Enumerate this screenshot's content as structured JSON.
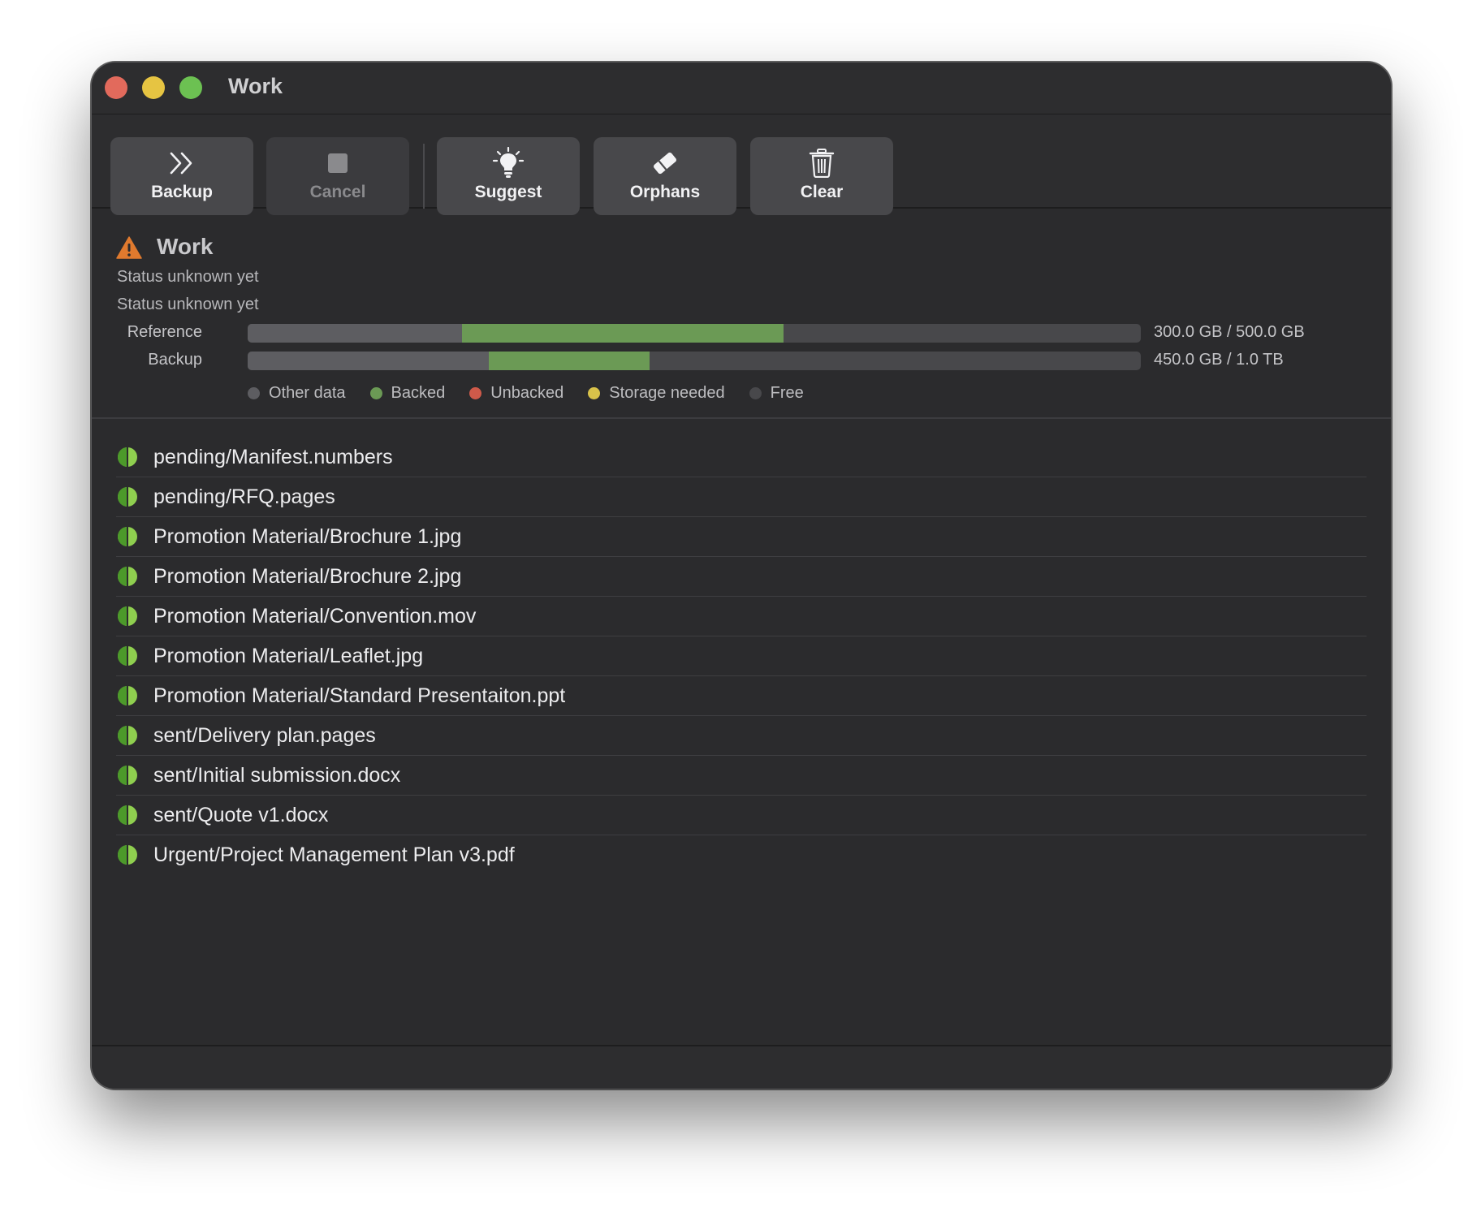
{
  "window": {
    "title": "Work"
  },
  "toolbar": {
    "buttons": [
      {
        "label": "Backup",
        "icon": "chevrons-right-icon",
        "enabled": true
      },
      {
        "label": "Cancel",
        "icon": "stop-icon",
        "enabled": false
      },
      {
        "label": "Suggest",
        "icon": "lightbulb-icon",
        "enabled": true
      },
      {
        "label": "Orphans",
        "icon": "eraser-icon",
        "enabled": true
      },
      {
        "label": "Clear",
        "icon": "trash-icon",
        "enabled": true
      }
    ]
  },
  "status": {
    "title": "Work",
    "icon": "warning-icon",
    "lines": [
      "Status unknown yet",
      "Status unknown yet"
    ],
    "bars": [
      {
        "label": "Reference",
        "value": "300.0 GB / 500.0 GB",
        "other_fraction": 0.24,
        "backed_fraction": 0.36
      },
      {
        "label": "Backup",
        "value": "450.0 GB / 1.0 TB",
        "other_fraction": 0.27,
        "backed_fraction": 0.18
      }
    ],
    "legend": [
      {
        "label": "Other data",
        "color": "#5d5d61"
      },
      {
        "label": "Backed",
        "color": "#6b9a55"
      },
      {
        "label": "Unbacked",
        "color": "#cf5a4a"
      },
      {
        "label": "Storage needed",
        "color": "#d8c24a"
      },
      {
        "label": "Free",
        "color": "#48484b"
      }
    ]
  },
  "files": [
    "pending/Manifest.numbers",
    "pending/RFQ.pages",
    "Promotion Material/Brochure 1.jpg",
    "Promotion Material/Brochure 2.jpg",
    "Promotion Material/Convention.mov",
    "Promotion Material/Leaflet.jpg",
    "Promotion Material/Standard Presentaiton.ppt",
    "sent/Delivery plan.pages",
    "sent/Initial submission.docx",
    "sent/Quote v1.docx",
    "Urgent/Project Management Plan v3.pdf"
  ],
  "colors": {
    "close": "#e26a5c",
    "minimize": "#e6c442",
    "zoom": "#6cc152",
    "file_status_light": "#8fcf4f",
    "file_status_dark": "#4c9a2a",
    "warning": "#e07a2e"
  }
}
